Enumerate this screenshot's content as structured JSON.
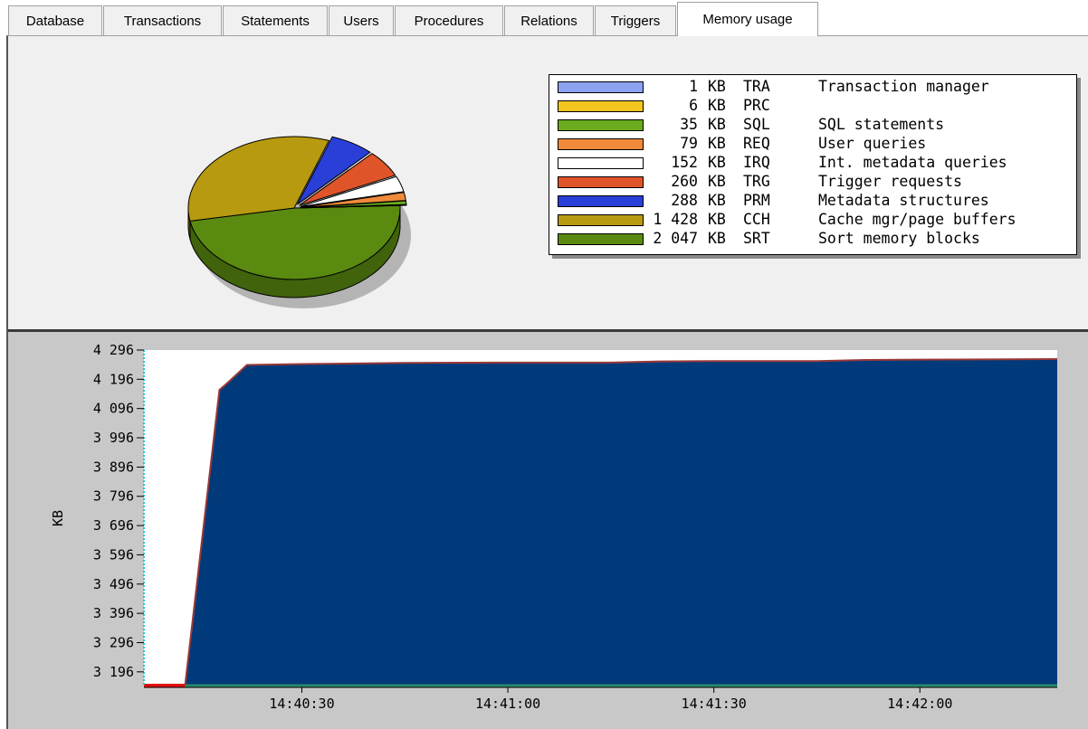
{
  "tabs": [
    {
      "label": "Database",
      "active": false
    },
    {
      "label": "Transactions",
      "active": false
    },
    {
      "label": "Statements",
      "active": false
    },
    {
      "label": "Users",
      "active": false
    },
    {
      "label": "Procedures",
      "active": false
    },
    {
      "label": "Relations",
      "active": false
    },
    {
      "label": "Triggers",
      "active": false
    },
    {
      "label": "Memory usage",
      "active": true
    }
  ],
  "legend": [
    {
      "value": "1",
      "unit": "KB",
      "code": "TRA",
      "desc": "Transaction manager",
      "color": "#8aa2f0"
    },
    {
      "value": "6",
      "unit": "KB",
      "code": "PRC",
      "desc": "",
      "color": "#f2c61e"
    },
    {
      "value": "35",
      "unit": "KB",
      "code": "SQL",
      "desc": "SQL statements",
      "color": "#6aac1e"
    },
    {
      "value": "79",
      "unit": "KB",
      "code": "REQ",
      "desc": "User queries",
      "color": "#f08a3a"
    },
    {
      "value": "152",
      "unit": "KB",
      "code": "IRQ",
      "desc": "Int. metadata queries",
      "color": "#ffffff"
    },
    {
      "value": "260",
      "unit": "KB",
      "code": "TRG",
      "desc": "Trigger requests",
      "color": "#e0542a"
    },
    {
      "value": "288",
      "unit": "KB",
      "code": "PRM",
      "desc": "Metadata structures",
      "color": "#2a3ed8"
    },
    {
      "value": "1 428",
      "unit": "KB",
      "code": "CCH",
      "desc": "Cache mgr/page buffers",
      "color": "#b89a10"
    },
    {
      "value": "2 047",
      "unit": "KB",
      "code": "SRT",
      "desc": "Sort memory blocks",
      "color": "#5a8a10"
    }
  ],
  "chart_data": [
    {
      "type": "pie",
      "title": "",
      "slices": [
        {
          "label": "Sort memory blocks",
          "value": 2047,
          "color": "#5a8a10"
        },
        {
          "label": "Cache mgr/page buffers",
          "value": 1428,
          "color": "#b89a10"
        },
        {
          "label": "Metadata structures",
          "value": 288,
          "color": "#2a3ed8"
        },
        {
          "label": "Trigger requests",
          "value": 260,
          "color": "#e0542a"
        },
        {
          "label": "Int. metadata queries",
          "value": 152,
          "color": "#ffffff"
        },
        {
          "label": "User queries",
          "value": 79,
          "color": "#f08a3a"
        },
        {
          "label": "SQL statements",
          "value": 35,
          "color": "#6aac1e"
        },
        {
          "label": "PRC",
          "value": 6,
          "color": "#f2c61e"
        },
        {
          "label": "Transaction manager",
          "value": 1,
          "color": "#8aa2f0"
        }
      ]
    },
    {
      "type": "area",
      "title": "",
      "xlabel": "",
      "ylabel": "KB",
      "ylim": [
        3146,
        4296
      ],
      "yticks": [
        3196,
        3296,
        3396,
        3496,
        3596,
        3696,
        3796,
        3896,
        3996,
        4096,
        4196,
        4296
      ],
      "ytick_labels": [
        "3 196",
        "3 296",
        "3 396",
        "3 496",
        "3 596",
        "3 696",
        "3 796",
        "3 896",
        "3 996",
        "4 096",
        "4 196",
        "4 296"
      ],
      "xlim": [
        "14:40:07",
        "14:42:20"
      ],
      "xticks": [
        "14:40:30",
        "14:41:00",
        "14:41:30",
        "14:42:00"
      ],
      "area_color": "#003a7a",
      "line_color": "#9a3838",
      "series": [
        {
          "x": [
            "14:40:07",
            "14:40:13",
            "14:40:18",
            "14:40:19",
            "14:40:22",
            "14:40:30",
            "14:40:45",
            "14:41:00",
            "14:41:15",
            "14:41:22",
            "14:41:30",
            "14:41:45",
            "14:41:52",
            "14:42:00",
            "14:42:10",
            "14:42:20"
          ],
          "values": [
            3150,
            3150,
            4160,
            4180,
            4245,
            4248,
            4252,
            4253,
            4253,
            4257,
            4258,
            4258,
            4262,
            4263,
            4264,
            4265
          ]
        }
      ]
    }
  ]
}
